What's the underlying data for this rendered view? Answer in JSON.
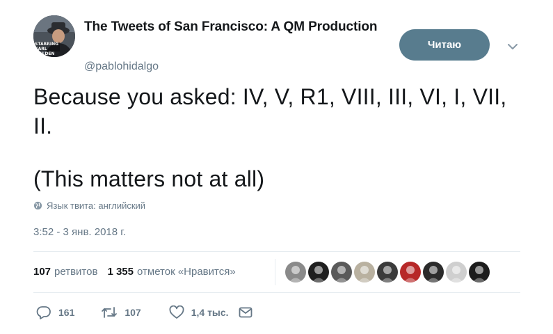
{
  "author": {
    "display_name": "The Tweets of San Francisco: A QM Production",
    "handle": "@pablohidalgo",
    "avatar_text": "STARRING KARL MALDEN"
  },
  "follow_button": {
    "label": "Читаю"
  },
  "tweet": {
    "lines": [
      "Because you asked: IV, V, R1, VIII, III, VI, I, VII,",
      "II.",
      "(This matters not at all)"
    ],
    "language_label": "Язык твита: английский",
    "timestamp": "3:52 - 3 янв. 2018 г."
  },
  "stats": {
    "retweets_count": "107",
    "retweets_label": "ретвитов",
    "likes_count": "1 355",
    "likes_label": "отметок «Нравится»"
  },
  "likers": [
    {
      "icon": "avatar-person",
      "color": "#8a8a8a"
    },
    {
      "icon": "avatar-cartoon-face",
      "color": "#1f1f1f"
    },
    {
      "icon": "avatar-robot",
      "color": "#5a5a5a"
    },
    {
      "icon": "avatar-person",
      "color": "#b9b1a0"
    },
    {
      "icon": "avatar-sign",
      "color": "#3b3b3b"
    },
    {
      "icon": "avatar-santa-hat",
      "color": "#b72828"
    },
    {
      "icon": "avatar-dark",
      "color": "#2b2b2b"
    },
    {
      "icon": "avatar-phone",
      "color": "#cfcfcf"
    },
    {
      "icon": "avatar-dark",
      "color": "#1c1c1c"
    }
  ],
  "actions": {
    "replies": "161",
    "retweets": "107",
    "likes": "1,4 тыс."
  },
  "colors": {
    "follow_bg": "#587c8e",
    "secondary_text": "#657786",
    "primary_text": "#14171a",
    "divider": "#e6ecf0"
  }
}
